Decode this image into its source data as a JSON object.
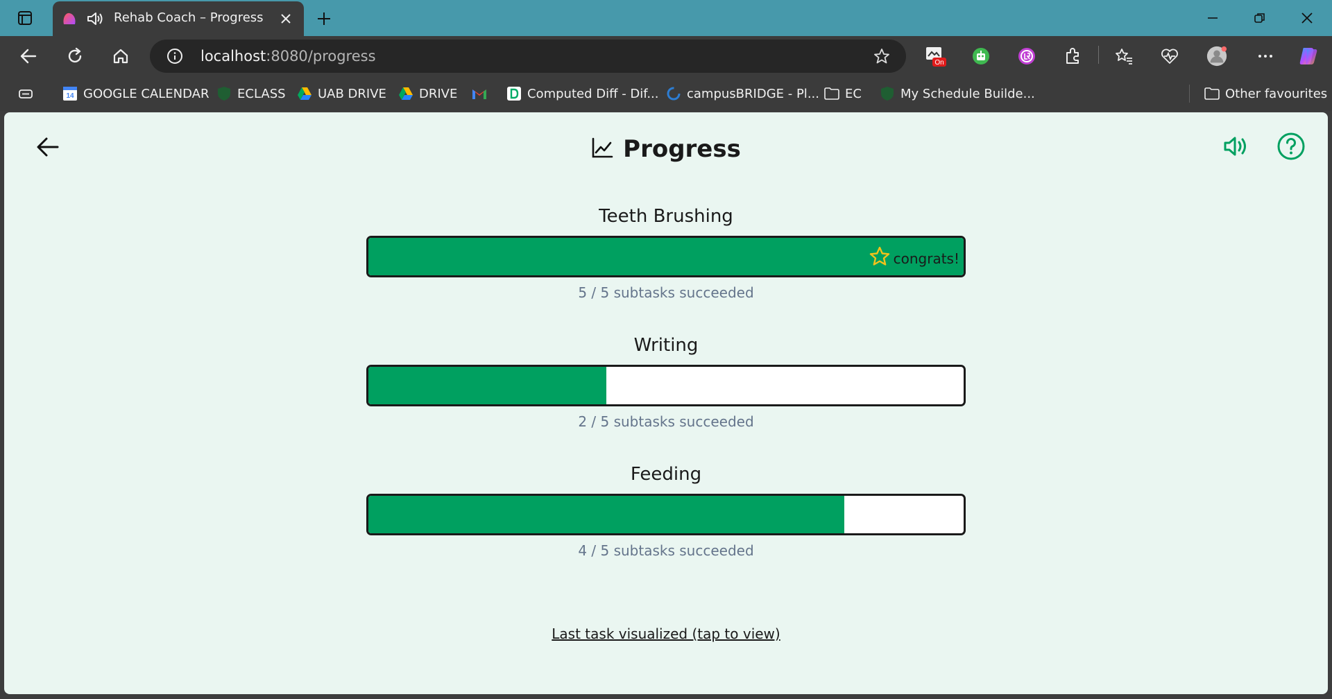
{
  "browser": {
    "tab": {
      "title": "Rehab Coach – Progress"
    },
    "address": {
      "host": "localhost",
      "rest": ":8080/progress"
    },
    "extensions": {
      "badge": "On"
    },
    "bookmarks": [
      {
        "label": "GOOGLE CALENDAR",
        "icon": "calendar-icon"
      },
      {
        "label": "ECLASS",
        "icon": "shield-icon"
      },
      {
        "label": "UAB DRIVE",
        "icon": "drive-icon"
      },
      {
        "label": "DRIVE",
        "icon": "drive-icon"
      },
      {
        "label": "",
        "icon": "gmail-icon"
      },
      {
        "label": "Computed Diff - Dif...",
        "icon": "diff-icon"
      },
      {
        "label": "campusBRIDGE - Pl...",
        "icon": "campusbridge-icon"
      },
      {
        "label": "EC",
        "icon": "folder-icon"
      },
      {
        "label": "My Schedule Builde...",
        "icon": "shield-icon"
      }
    ],
    "other_favourites": "Other favourites"
  },
  "page": {
    "title": "Progress",
    "tasks": [
      {
        "name": "Teeth Brushing",
        "done": 5,
        "total": 5,
        "count_text": "5 / 5 subtasks succeeded",
        "congrats": "congrats!"
      },
      {
        "name": "Writing",
        "done": 2,
        "total": 5,
        "count_text": "2 / 5 subtasks succeeded",
        "congrats": ""
      },
      {
        "name": "Feeding",
        "done": 4,
        "total": 5,
        "count_text": "4 / 5 subtasks succeeded",
        "congrats": ""
      }
    ],
    "last_task_link": "Last task visualized (tap to view)"
  },
  "colors": {
    "progress_fill": "#00a060",
    "accent": "#00a060",
    "tabstrip": "#4799ab",
    "page_bg": "#eaf6f1"
  }
}
